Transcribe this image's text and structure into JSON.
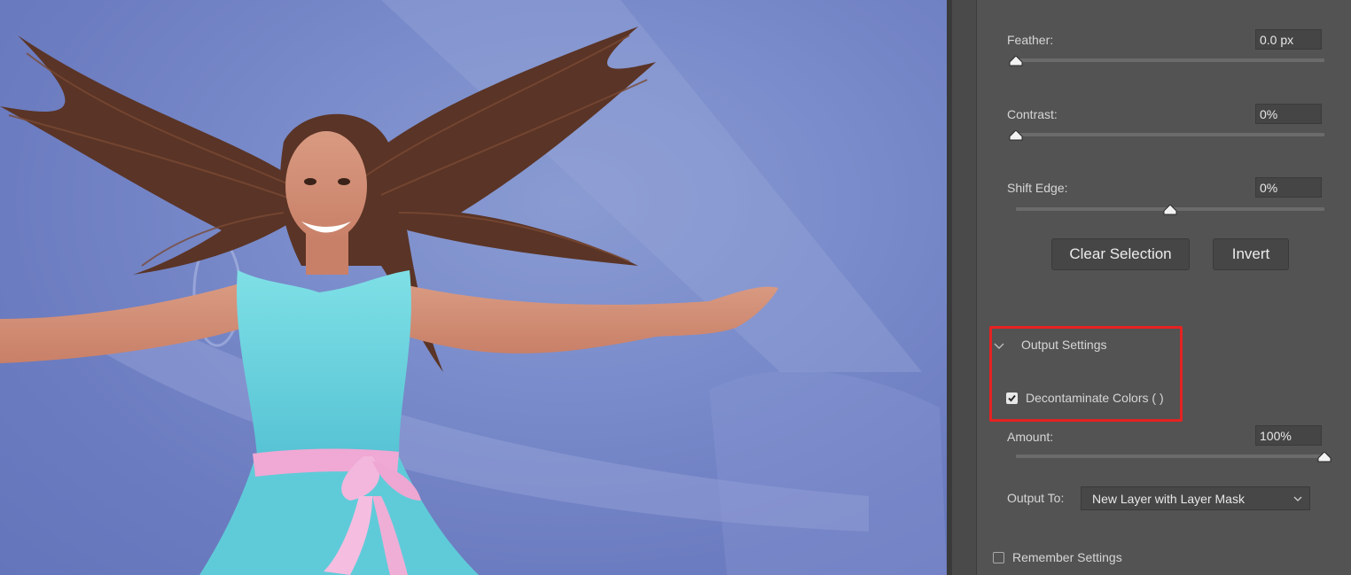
{
  "canvas": {
    "image_description_icon": "photo-woman-flying-hair-icon",
    "background_color": "#7585c6"
  },
  "panel": {
    "feather": {
      "label": "Feather:",
      "value": "0.0 px",
      "slider_fraction": 0.0
    },
    "contrast": {
      "label": "Contrast:",
      "value": "0%",
      "slider_fraction": 0.0
    },
    "shift_edge": {
      "label": "Shift Edge:",
      "value": "0%",
      "slider_fraction": 0.5
    },
    "buttons": {
      "clear_selection": "Clear Selection",
      "invert": "Invert"
    },
    "output_settings": {
      "header": "Output Settings",
      "expanded": true,
      "decontaminate": {
        "label": "Decontaminate Colors (   )",
        "checked": true
      },
      "amount": {
        "label": "Amount:",
        "value": "100%",
        "slider_fraction": 1.0
      },
      "output_to": {
        "label": "Output To:",
        "selected": "New Layer with Layer Mask"
      }
    },
    "remember": {
      "label": "Remember Settings",
      "checked": false
    },
    "highlight_color": "#e62222"
  }
}
